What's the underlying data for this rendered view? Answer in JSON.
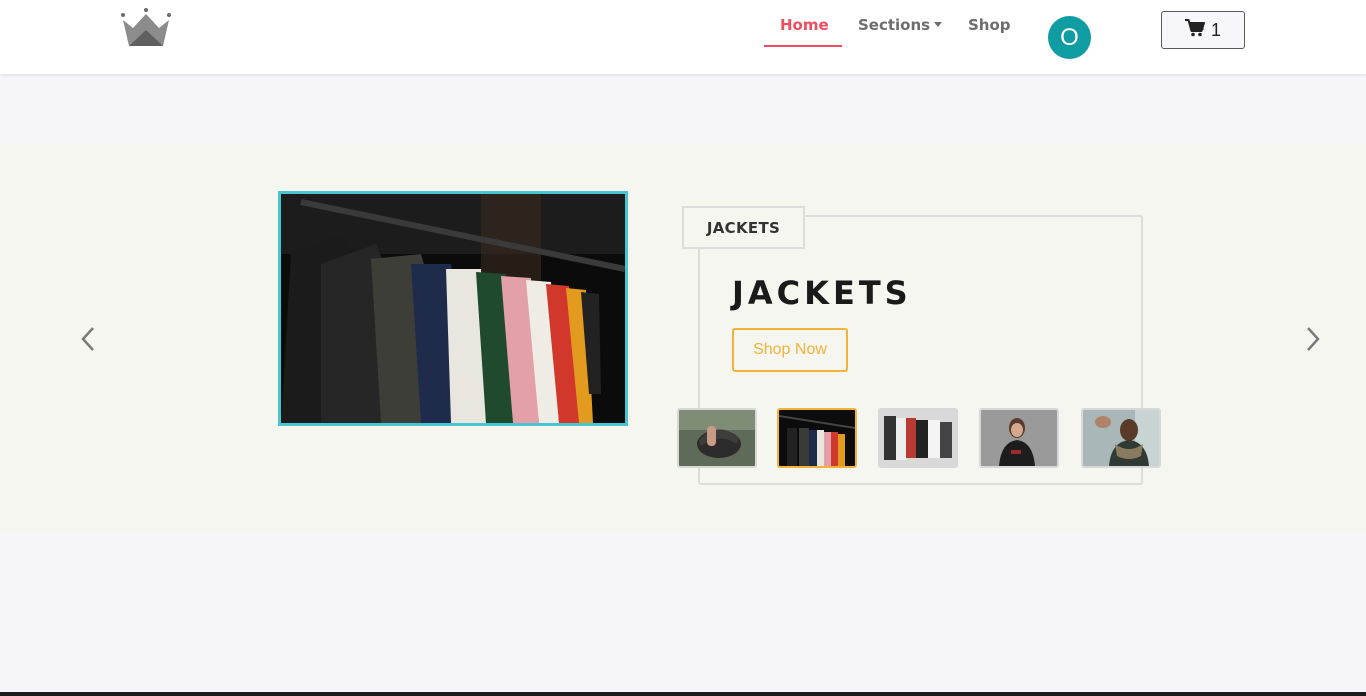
{
  "navbar": {
    "logo_icon": "crown-icon",
    "links": {
      "home": "Home",
      "sections": "Sections",
      "shop": "Shop"
    },
    "active_link": "home",
    "user_initial": "O",
    "cart": {
      "icon": "cart-icon",
      "count": "1"
    }
  },
  "colors": {
    "accent_red": "#ee4c5f",
    "avatar_teal": "#0f9da3",
    "image_border": "#47c5d1",
    "cta_gold": "#f3b23a",
    "hero_bg": "#f6f6f1",
    "page_bg": "#f5f5fa"
  },
  "carousel": {
    "prev_icon": "chevron-left-icon",
    "next_icon": "chevron-right-icon",
    "slide": {
      "category": "JACKETS",
      "title": "JACKETS",
      "cta": "Shop Now",
      "image": "clothes-rack-image"
    },
    "thumbnails": [
      {
        "name": "cap-thumbnail"
      },
      {
        "name": "clothes-rack-thumbnail",
        "active": true
      },
      {
        "name": "hoodies-thumbnail"
      },
      {
        "name": "woman-portrait-thumbnail"
      },
      {
        "name": "man-scarf-thumbnail"
      }
    ]
  }
}
